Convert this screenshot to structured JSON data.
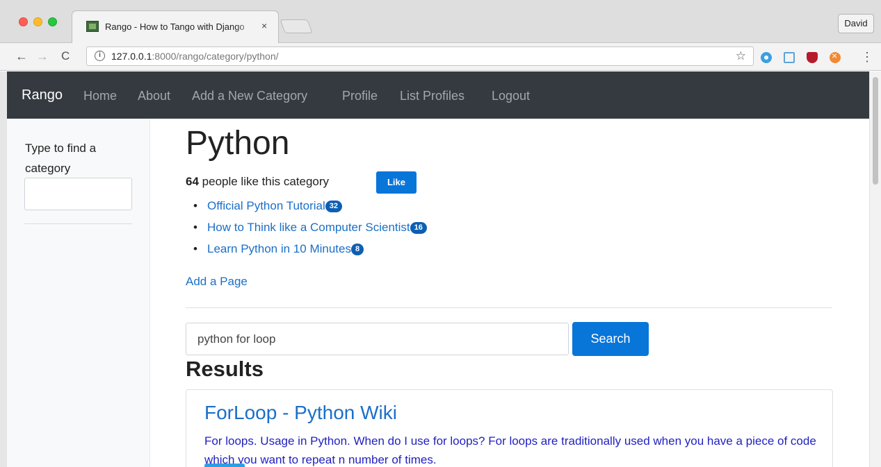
{
  "browser": {
    "tab_title": "Rango - How to Tango with Django",
    "tab_close": "×",
    "user_button": "David",
    "url_host": "127.0.0.1",
    "url_rest": ":8000/rango/category/python/",
    "nav": {
      "back": "←",
      "forward": "→",
      "reload": "C",
      "star": "☆",
      "menu": "⋮",
      "info": "i"
    }
  },
  "navbar": {
    "brand": "Rango",
    "links": [
      "Home",
      "About",
      "Add a New Category",
      "Profile",
      "List Profiles",
      "Logout"
    ]
  },
  "sidebar": {
    "label": "Type to find a category",
    "input_value": ""
  },
  "category": {
    "title": "Python",
    "likes_count": "64",
    "likes_text": "people like this category",
    "like_button": "Like",
    "pages": [
      {
        "title": "Official Python Tutorial",
        "views": "32"
      },
      {
        "title": "How to Think like a Computer Scientist",
        "views": "16"
      },
      {
        "title": "Learn Python in 10 Minutes",
        "views": "8"
      }
    ],
    "add_page": "Add a Page"
  },
  "search": {
    "query": "python for loop",
    "button": "Search",
    "results_heading": "Results",
    "results": [
      {
        "title": "ForLoop - Python Wiki",
        "summary": "For loops. Usage in Python. When do I use for loops? For loops are traditionally used when you have a piece of code which you want to repeat n number of times."
      }
    ]
  },
  "colors": {
    "navbar_bg": "#343a40",
    "primary": "#0875d9",
    "link": "#1a6fc9",
    "badge": "#0d5fb3"
  }
}
